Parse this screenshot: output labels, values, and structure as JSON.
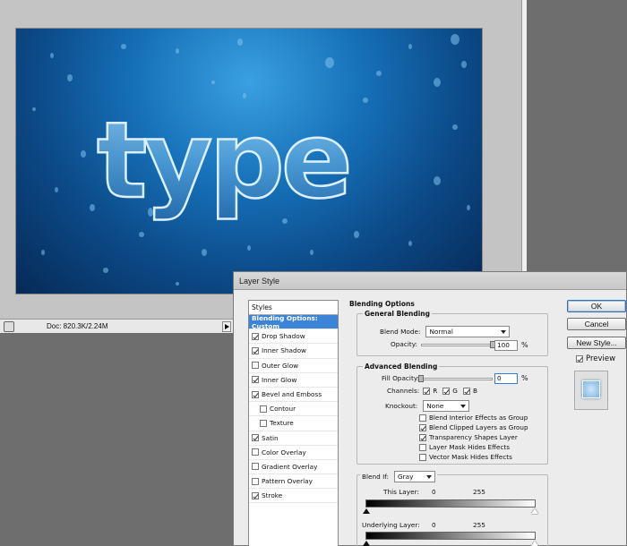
{
  "status": {
    "doc_size": "Doc: 820.3K/2.24M"
  },
  "canvas": {
    "text": "type"
  },
  "dialog": {
    "title": "Layer Style",
    "styles": {
      "header": "Styles",
      "items": [
        {
          "label": "Blending Options: Custom",
          "checked": null,
          "selected": true
        },
        {
          "label": "Drop Shadow",
          "checked": true
        },
        {
          "label": "Inner Shadow",
          "checked": true
        },
        {
          "label": "Outer Glow",
          "checked": false
        },
        {
          "label": "Inner Glow",
          "checked": true
        },
        {
          "label": "Bevel and Emboss",
          "checked": true
        },
        {
          "label": "Contour",
          "checked": false,
          "indent": true
        },
        {
          "label": "Texture",
          "checked": false,
          "indent": true
        },
        {
          "label": "Satin",
          "checked": true
        },
        {
          "label": "Color Overlay",
          "checked": false
        },
        {
          "label": "Gradient Overlay",
          "checked": false
        },
        {
          "label": "Pattern Overlay",
          "checked": false
        },
        {
          "label": "Stroke",
          "checked": true
        }
      ]
    },
    "blending_options": {
      "title": "Blending Options",
      "general": {
        "title": "General Blending",
        "blend_mode_label": "Blend Mode:",
        "blend_mode_value": "Normal",
        "opacity_label": "Opacity:",
        "opacity_value": "100",
        "opacity_unit": "%",
        "opacity_fraction": 1.0
      },
      "advanced": {
        "title": "Advanced Blending",
        "fill_opacity_label": "Fill Opacity:",
        "fill_opacity_value": "0",
        "fill_opacity_unit": "%",
        "fill_opacity_fraction": 0.0,
        "channels_label": "Channels:",
        "channels": [
          {
            "label": "R",
            "checked": true
          },
          {
            "label": "G",
            "checked": true
          },
          {
            "label": "B",
            "checked": true
          }
        ],
        "knockout_label": "Knockout:",
        "knockout_value": "None",
        "options": [
          {
            "label": "Blend Interior Effects as Group",
            "checked": false
          },
          {
            "label": "Blend Clipped Layers as Group",
            "checked": true
          },
          {
            "label": "Transparency Shapes Layer",
            "checked": true
          },
          {
            "label": "Layer Mask Hides Effects",
            "checked": false
          },
          {
            "label": "Vector Mask Hides Effects",
            "checked": false
          }
        ]
      },
      "blend_if": {
        "label": "Blend If:",
        "value": "Gray",
        "this_layer_label": "This Layer:",
        "this_layer_min": "0",
        "this_layer_max": "255",
        "underlying_label": "Underlying Layer:",
        "underlying_min": "0",
        "underlying_max": "255"
      }
    },
    "buttons": {
      "ok": "OK",
      "cancel": "Cancel",
      "new_style": "New Style...",
      "preview_label": "Preview",
      "preview_checked": true
    }
  }
}
